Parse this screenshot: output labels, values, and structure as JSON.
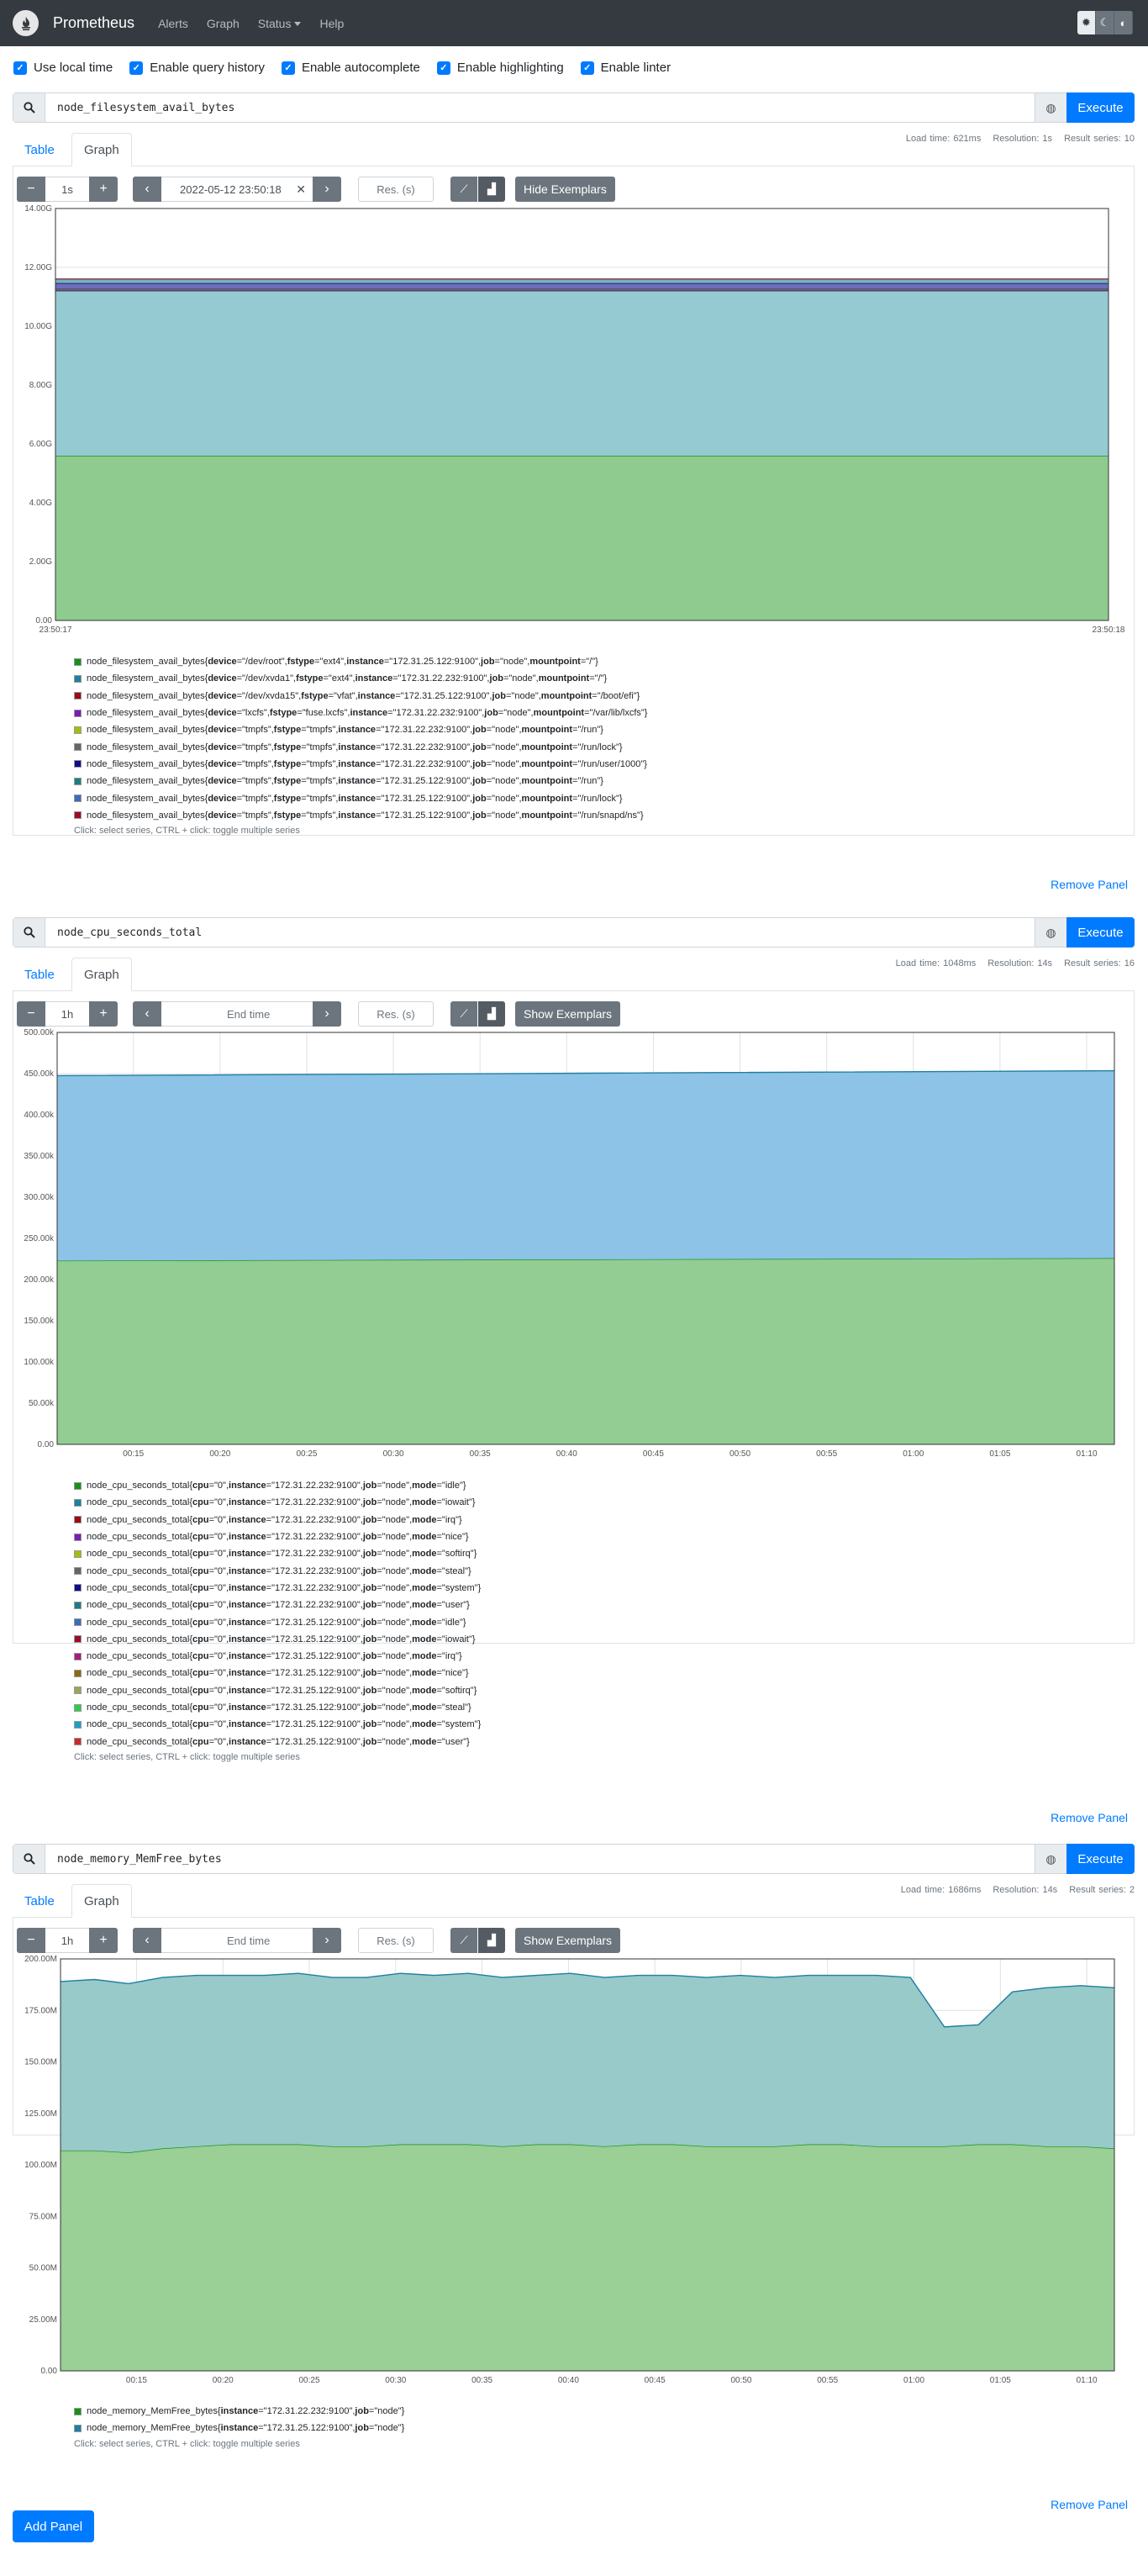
{
  "nav": {
    "brand": "Prometheus",
    "links": [
      "Alerts",
      "Graph",
      "Status",
      "Help"
    ]
  },
  "options": [
    "Use local time",
    "Enable query history",
    "Enable autocomplete",
    "Enable highlighting",
    "Enable linter"
  ],
  "add_panel": "Add Panel",
  "panels": [
    {
      "expr": "node_filesystem_avail_bytes",
      "execute": "Execute",
      "stats": {
        "load": "Load time: 621ms",
        "resolution": "Resolution: 1s",
        "series": "Result series: 10"
      },
      "tabs": [
        "Table",
        "Graph"
      ],
      "range": "1s",
      "end_time": "2022-05-12 23:50:18",
      "res_placeholder": "Res. (s)",
      "exemplars": "Hide Exemplars",
      "remove": "Remove Panel",
      "chart_data": {
        "type": "area",
        "ylim": [
          0,
          14
        ],
        "yticks": [
          "0.00",
          "2.00G",
          "4.00G",
          "6.00G",
          "8.00G",
          "10.00G",
          "12.00G",
          "14.00G"
        ],
        "xticks": [
          "23:50:17",
          "23:50:18"
        ],
        "series": [
          {
            "values": [
              5.6,
              5.6
            ]
          },
          {
            "values": [
              5.6,
              5.6
            ]
          },
          {
            "values": [
              0.04,
              0.04
            ]
          },
          {
            "values": [
              0.01,
              0.01
            ]
          },
          {
            "values": [
              0.001,
              0.001
            ]
          },
          {
            "values": [
              0.001,
              0.001
            ]
          },
          {
            "values": [
              0.2,
              0.2
            ]
          },
          {
            "values": [
              0.15,
              0.15
            ]
          },
          {
            "values": [
              0.001,
              0.001
            ]
          },
          {
            "values": [
              0.001,
              0.001
            ]
          }
        ]
      },
      "legend": [
        {
          "m": "node_filesystem_avail_bytes",
          "l": [
            [
              "device",
              "/dev/root"
            ],
            [
              "fstype",
              "ext4"
            ],
            [
              "instance",
              "172.31.25.122:9100"
            ],
            [
              "job",
              "node"
            ],
            [
              "mountpoint",
              "/"
            ]
          ],
          "c": "#169218"
        },
        {
          "m": "node_filesystem_avail_bytes",
          "l": [
            [
              "device",
              "/dev/xvda1"
            ],
            [
              "fstype",
              "ext4"
            ],
            [
              "instance",
              "172.31.22.232:9100"
            ],
            [
              "job",
              "node"
            ],
            [
              "mountpoint",
              "/"
            ]
          ],
          "c": "#1f7ea2"
        },
        {
          "m": "node_filesystem_avail_bytes",
          "l": [
            [
              "device",
              "/dev/xvda15"
            ],
            [
              "fstype",
              "vfat"
            ],
            [
              "instance",
              "172.31.25.122:9100"
            ],
            [
              "job",
              "node"
            ],
            [
              "mountpoint",
              "/boot/efi"
            ]
          ],
          "c": "#9b0a15"
        },
        {
          "m": "node_filesystem_avail_bytes",
          "l": [
            [
              "device",
              "lxcfs"
            ],
            [
              "fstype",
              "fuse.lxcfs"
            ],
            [
              "instance",
              "172.31.22.232:9100"
            ],
            [
              "job",
              "node"
            ],
            [
              "mountpoint",
              "/var/lib/lxcfs"
            ]
          ],
          "c": "#761fb8"
        },
        {
          "m": "node_filesystem_avail_bytes",
          "l": [
            [
              "device",
              "tmpfs"
            ],
            [
              "fstype",
              "tmpfs"
            ],
            [
              "instance",
              "172.31.22.232:9100"
            ],
            [
              "job",
              "node"
            ],
            [
              "mountpoint",
              "/run"
            ]
          ],
          "c": "#a3bf0a"
        },
        {
          "m": "node_filesystem_avail_bytes",
          "l": [
            [
              "device",
              "tmpfs"
            ],
            [
              "fstype",
              "tmpfs"
            ],
            [
              "instance",
              "172.31.22.232:9100"
            ],
            [
              "job",
              "node"
            ],
            [
              "mountpoint",
              "/run/lock"
            ]
          ],
          "c": "#666666"
        },
        {
          "m": "node_filesystem_avail_bytes",
          "l": [
            [
              "device",
              "tmpfs"
            ],
            [
              "fstype",
              "tmpfs"
            ],
            [
              "instance",
              "172.31.22.232:9100"
            ],
            [
              "job",
              "node"
            ],
            [
              "mountpoint",
              "/run/user/1000"
            ]
          ],
          "c": "#0d0d8c"
        },
        {
          "m": "node_filesystem_avail_bytes",
          "l": [
            [
              "device",
              "tmpfs"
            ],
            [
              "fstype",
              "tmpfs"
            ],
            [
              "instance",
              "172.31.25.122:9100"
            ],
            [
              "job",
              "node"
            ],
            [
              "mountpoint",
              "/run"
            ]
          ],
          "c": "#1e7c84"
        },
        {
          "m": "node_filesystem_avail_bytes",
          "l": [
            [
              "device",
              "tmpfs"
            ],
            [
              "fstype",
              "tmpfs"
            ],
            [
              "instance",
              "172.31.25.122:9100"
            ],
            [
              "job",
              "node"
            ],
            [
              "mountpoint",
              "/run/lock"
            ]
          ],
          "c": "#3c6db8"
        },
        {
          "m": "node_filesystem_avail_bytes",
          "l": [
            [
              "device",
              "tmpfs"
            ],
            [
              "fstype",
              "tmpfs"
            ],
            [
              "instance",
              "172.31.25.122:9100"
            ],
            [
              "job",
              "node"
            ],
            [
              "mountpoint",
              "/run/snapd/ns"
            ]
          ],
          "c": "#9a0c28"
        }
      ],
      "hint": "Click: select series, CTRL + click: toggle multiple series"
    },
    {
      "expr": "node_cpu_seconds_total",
      "execute": "Execute",
      "stats": {
        "load": "Load time: 1048ms",
        "resolution": "Resolution: 14s",
        "series": "Result series: 16"
      },
      "tabs": [
        "Table",
        "Graph"
      ],
      "range": "1h",
      "end_time": "",
      "end_placeholder": "End time",
      "res_placeholder": "Res. (s)",
      "exemplars": "Show Exemplars",
      "remove": "Remove Panel",
      "chart_data": {
        "type": "area",
        "ylim": [
          0,
          500000
        ],
        "yticks": [
          "0.00",
          "50.00k",
          "100.00k",
          "150.00k",
          "200.00k",
          "250.00k",
          "300.00k",
          "350.00k",
          "400.00k",
          "450.00k",
          "500.00k"
        ],
        "xticks": [
          "00:15",
          "00:20",
          "00:25",
          "00:30",
          "00:35",
          "00:40",
          "00:45",
          "00:50",
          "00:55",
          "01:00",
          "01:05",
          "01:10"
        ],
        "series": [
          {
            "values": [
              223000,
              224500,
              226000
            ]
          },
          {
            "values": [
              224500,
              226000,
              227500
            ]
          }
        ]
      },
      "legend": [
        {
          "m": "node_cpu_seconds_total",
          "l": [
            [
              "cpu",
              "0"
            ],
            [
              "instance",
              "172.31.22.232:9100"
            ],
            [
              "job",
              "node"
            ],
            [
              "mode",
              "idle"
            ]
          ],
          "c": "#169218"
        },
        {
          "m": "node_cpu_seconds_total",
          "l": [
            [
              "cpu",
              "0"
            ],
            [
              "instance",
              "172.31.22.232:9100"
            ],
            [
              "job",
              "node"
            ],
            [
              "mode",
              "iowait"
            ]
          ],
          "c": "#1f7ea2"
        },
        {
          "m": "node_cpu_seconds_total",
          "l": [
            [
              "cpu",
              "0"
            ],
            [
              "instance",
              "172.31.22.232:9100"
            ],
            [
              "job",
              "node"
            ],
            [
              "mode",
              "irq"
            ]
          ],
          "c": "#9b0a15"
        },
        {
          "m": "node_cpu_seconds_total",
          "l": [
            [
              "cpu",
              "0"
            ],
            [
              "instance",
              "172.31.22.232:9100"
            ],
            [
              "job",
              "node"
            ],
            [
              "mode",
              "nice"
            ]
          ],
          "c": "#761fb8"
        },
        {
          "m": "node_cpu_seconds_total",
          "l": [
            [
              "cpu",
              "0"
            ],
            [
              "instance",
              "172.31.22.232:9100"
            ],
            [
              "job",
              "node"
            ],
            [
              "mode",
              "softirq"
            ]
          ],
          "c": "#a3bf0a"
        },
        {
          "m": "node_cpu_seconds_total",
          "l": [
            [
              "cpu",
              "0"
            ],
            [
              "instance",
              "172.31.22.232:9100"
            ],
            [
              "job",
              "node"
            ],
            [
              "mode",
              "steal"
            ]
          ],
          "c": "#666666"
        },
        {
          "m": "node_cpu_seconds_total",
          "l": [
            [
              "cpu",
              "0"
            ],
            [
              "instance",
              "172.31.22.232:9100"
            ],
            [
              "job",
              "node"
            ],
            [
              "mode",
              "system"
            ]
          ],
          "c": "#0d0d8c"
        },
        {
          "m": "node_cpu_seconds_total",
          "l": [
            [
              "cpu",
              "0"
            ],
            [
              "instance",
              "172.31.22.232:9100"
            ],
            [
              "job",
              "node"
            ],
            [
              "mode",
              "user"
            ]
          ],
          "c": "#1e7c84"
        },
        {
          "m": "node_cpu_seconds_total",
          "l": [
            [
              "cpu",
              "0"
            ],
            [
              "instance",
              "172.31.25.122:9100"
            ],
            [
              "job",
              "node"
            ],
            [
              "mode",
              "idle"
            ]
          ],
          "c": "#3c6db8"
        },
        {
          "m": "node_cpu_seconds_total",
          "l": [
            [
              "cpu",
              "0"
            ],
            [
              "instance",
              "172.31.25.122:9100"
            ],
            [
              "job",
              "node"
            ],
            [
              "mode",
              "iowait"
            ]
          ],
          "c": "#9a0c28"
        },
        {
          "m": "node_cpu_seconds_total",
          "l": [
            [
              "cpu",
              "0"
            ],
            [
              "instance",
              "172.31.25.122:9100"
            ],
            [
              "job",
              "node"
            ],
            [
              "mode",
              "irq"
            ]
          ],
          "c": "#a51d7e"
        },
        {
          "m": "node_cpu_seconds_total",
          "l": [
            [
              "cpu",
              "0"
            ],
            [
              "instance",
              "172.31.25.122:9100"
            ],
            [
              "job",
              "node"
            ],
            [
              "mode",
              "nice"
            ]
          ],
          "c": "#8b6914"
        },
        {
          "m": "node_cpu_seconds_total",
          "l": [
            [
              "cpu",
              "0"
            ],
            [
              "instance",
              "172.31.25.122:9100"
            ],
            [
              "job",
              "node"
            ],
            [
              "mode",
              "softirq"
            ]
          ],
          "c": "#9aa55a"
        },
        {
          "m": "node_cpu_seconds_total",
          "l": [
            [
              "cpu",
              "0"
            ],
            [
              "instance",
              "172.31.25.122:9100"
            ],
            [
              "job",
              "node"
            ],
            [
              "mode",
              "steal"
            ]
          ],
          "c": "#2ccc4c"
        },
        {
          "m": "node_cpu_seconds_total",
          "l": [
            [
              "cpu",
              "0"
            ],
            [
              "instance",
              "172.31.25.122:9100"
            ],
            [
              "job",
              "node"
            ],
            [
              "mode",
              "system"
            ]
          ],
          "c": "#1ea0c5"
        },
        {
          "m": "node_cpu_seconds_total",
          "l": [
            [
              "cpu",
              "0"
            ],
            [
              "instance",
              "172.31.25.122:9100"
            ],
            [
              "job",
              "node"
            ],
            [
              "mode",
              "user"
            ]
          ],
          "c": "#cc2a2a"
        }
      ],
      "hint": "Click: select series, CTRL + click: toggle multiple series"
    },
    {
      "expr": "node_memory_MemFree_bytes",
      "execute": "Execute",
      "stats": {
        "load": "Load time: 1686ms",
        "resolution": "Resolution: 14s",
        "series": "Result series: 2"
      },
      "tabs": [
        "Table",
        "Graph"
      ],
      "range": "1h",
      "end_time": "",
      "end_placeholder": "End time",
      "res_placeholder": "Res. (s)",
      "exemplars": "Show Exemplars",
      "remove": "Remove Panel",
      "chart_data": {
        "type": "area",
        "ylim": [
          0,
          200000000
        ],
        "yticks": [
          "0.00",
          "25.00M",
          "50.00M",
          "75.00M",
          "100.00M",
          "125.00M",
          "150.00M",
          "175.00M",
          "200.00M"
        ],
        "xticks": [
          "00:15",
          "00:20",
          "00:25",
          "00:30",
          "00:35",
          "00:40",
          "00:45",
          "00:50",
          "00:55",
          "01:00",
          "01:05",
          "01:10"
        ],
        "series": [
          {
            "values": [
              107,
              107,
              106,
              108,
              109,
              110,
              110,
              110,
              109,
              109,
              110,
              110,
              110,
              109,
              110,
              110,
              109,
              110,
              110,
              109,
              109,
              109,
              110,
              110,
              109,
              109,
              109,
              110,
              110,
              109,
              109,
              108
            ]
          },
          {
            "values": [
              82,
              83,
              82,
              83,
              83,
              82,
              82,
              83,
              82,
              82,
              83,
              82,
              83,
              82,
              82,
              83,
              82,
              82,
              82,
              82,
              83,
              82,
              82,
              82,
              83,
              82,
              58,
              58,
              74,
              77,
              78,
              78
            ]
          }
        ]
      },
      "legend": [
        {
          "m": "node_memory_MemFree_bytes",
          "l": [
            [
              "instance",
              "172.31.22.232:9100"
            ],
            [
              "job",
              "node"
            ]
          ],
          "c": "#169218"
        },
        {
          "m": "node_memory_MemFree_bytes",
          "l": [
            [
              "instance",
              "172.31.25.122:9100"
            ],
            [
              "job",
              "node"
            ]
          ],
          "c": "#1f7ea2"
        }
      ],
      "hint": "Click: select series, CTRL + click: toggle multiple series"
    }
  ]
}
